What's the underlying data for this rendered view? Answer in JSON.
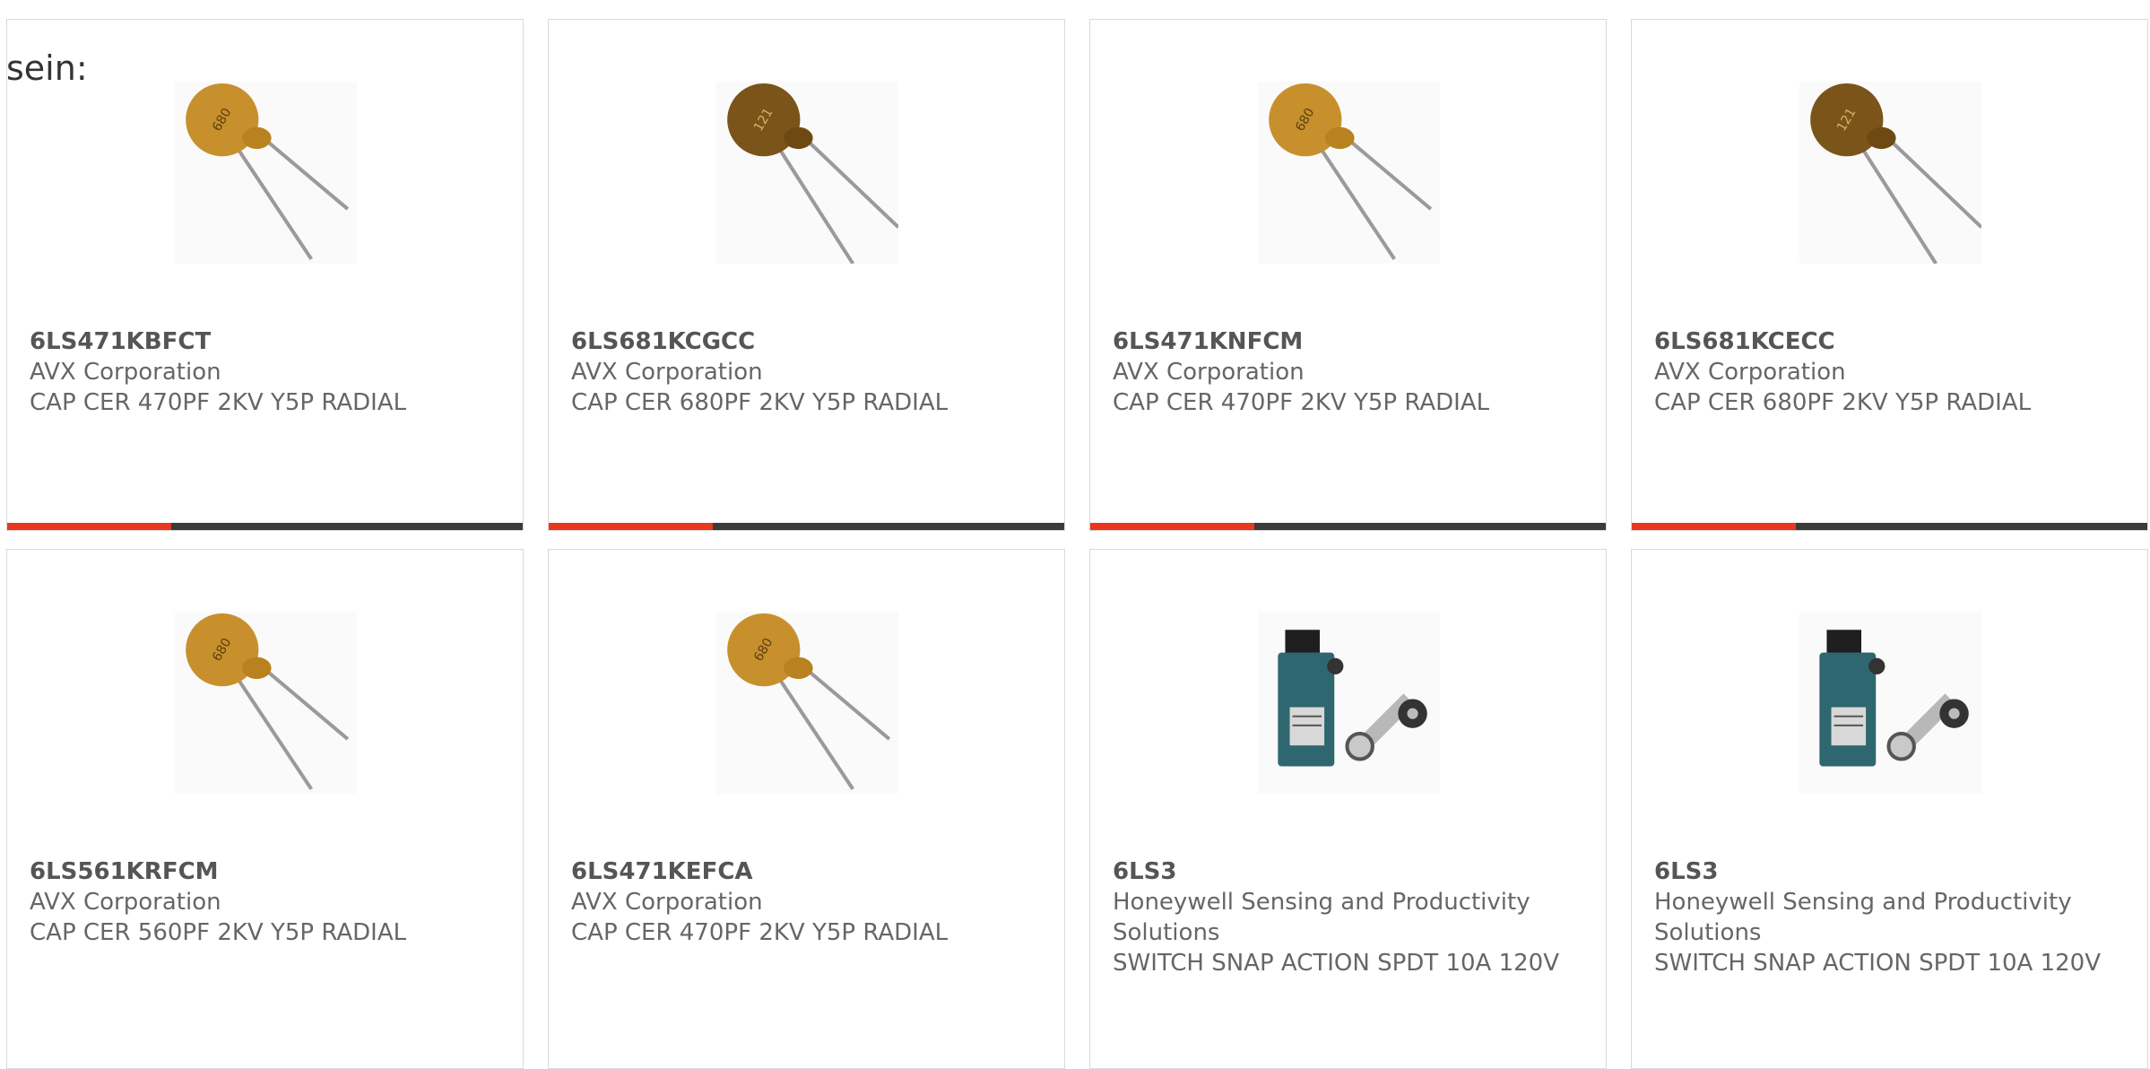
{
  "label": "sein:",
  "colors": {
    "accent": "#e8381e",
    "bar": "#3b3b3b",
    "part_number": "#555555",
    "text": "#666666"
  },
  "products": [
    {
      "part_number": "6LS471KBFCT",
      "manufacturer": "AVX Corporation",
      "description": "CAP CER 470PF 2KV Y5P RADIAL",
      "image_icon": "ceramic-capacitor-icon"
    },
    {
      "part_number": "6LS681KCGCC",
      "manufacturer": "AVX Corporation",
      "description": "CAP CER 680PF 2KV Y5P RADIAL",
      "image_icon": "ceramic-capacitor-icon"
    },
    {
      "part_number": "6LS471KNFCM",
      "manufacturer": "AVX Corporation",
      "description": "CAP CER 470PF 2KV Y5P RADIAL",
      "image_icon": "ceramic-capacitor-icon"
    },
    {
      "part_number": "6LS681KCECC",
      "manufacturer": "AVX Corporation",
      "description": "CAP CER 680PF 2KV Y5P RADIAL",
      "image_icon": "ceramic-capacitor-icon"
    },
    {
      "part_number": "6LS561KRFCM",
      "manufacturer": "AVX Corporation",
      "description": "CAP CER 560PF 2KV Y5P RADIAL",
      "image_icon": "ceramic-capacitor-icon"
    },
    {
      "part_number": "6LS471KEFCA",
      "manufacturer": "AVX Corporation",
      "description": "CAP CER 470PF 2KV Y5P RADIAL",
      "image_icon": "ceramic-capacitor-icon"
    },
    {
      "part_number": "6LS3",
      "manufacturer": "Honeywell Sensing and Productivity Solutions",
      "description": "SWITCH SNAP ACTION SPDT 10A 120V",
      "image_icon": "limit-switch-icon"
    },
    {
      "part_number": "6LS3",
      "manufacturer": "Honeywell Sensing and Productivity Solutions",
      "description": "SWITCH SNAP ACTION SPDT 10A 120V",
      "image_icon": "limit-switch-icon"
    }
  ]
}
